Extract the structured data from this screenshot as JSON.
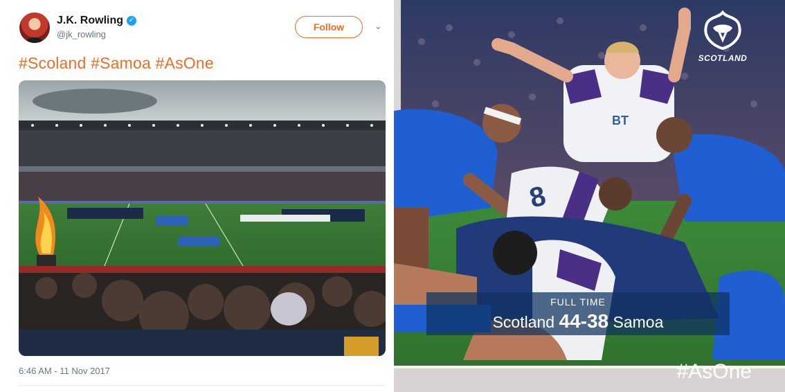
{
  "tweet": {
    "author_name": "J.K. Rowling",
    "handle": "@jk_rowling",
    "follow_label": "Follow",
    "text": "#Scoland #Samoa #AsOne",
    "timestamp": "6:46 AM - 11 Nov 2017",
    "accent_color": "#f26b21",
    "icons": [
      "verified-badge-icon",
      "chevron-down-icon"
    ]
  },
  "rugby": {
    "crest_label": "SCOTLAND",
    "result_label": "FULL TIME",
    "home_team": "Scotland",
    "score": "44-38",
    "away_team": "Samoa",
    "hashtag": "#AsOne"
  }
}
